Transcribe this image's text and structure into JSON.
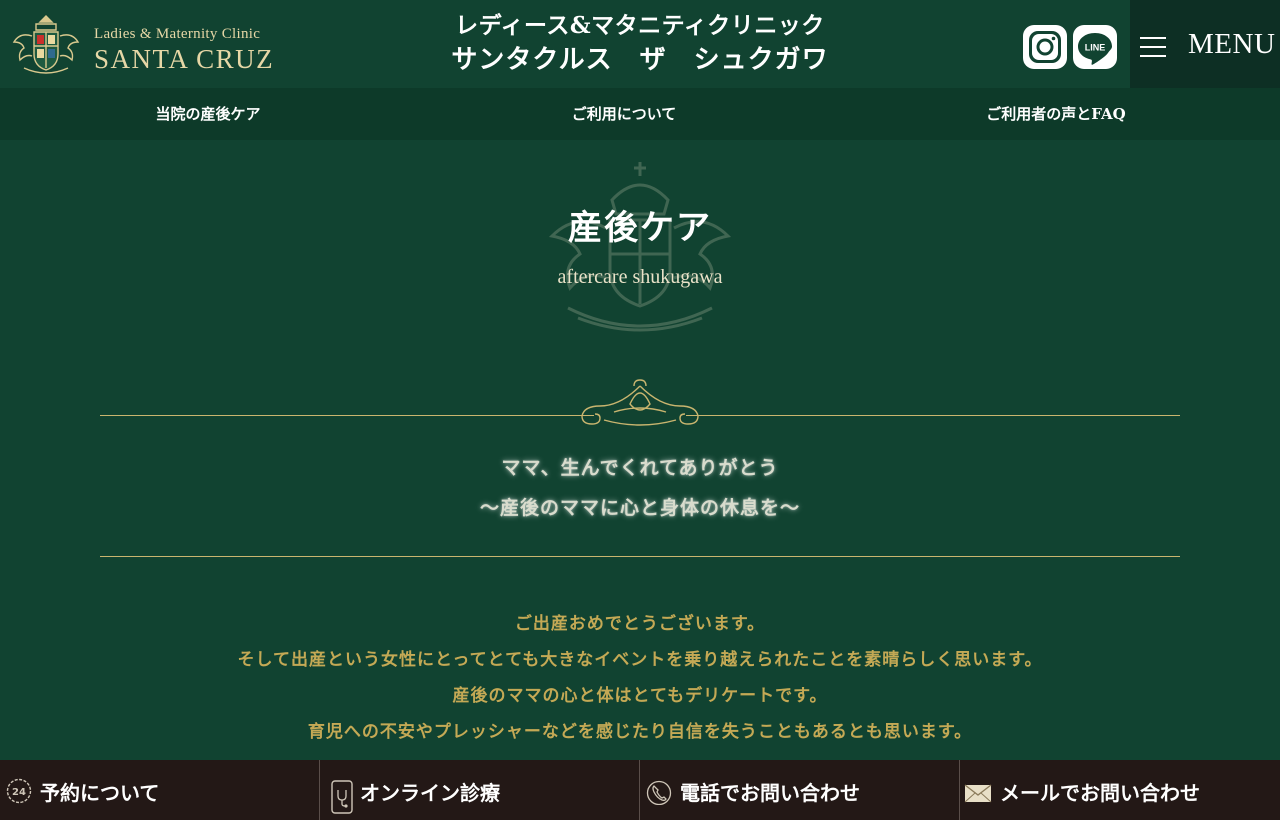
{
  "header": {
    "logo_sub": "Ladies & Maternity Clinic",
    "logo_main": "SANTA CRUZ",
    "title_line1": "レディース&マタニティクリニック",
    "title_line2": "サンタクルス　ザ　シュクガワ",
    "instagram_icon": "instagram-icon",
    "line_icon": "line-icon",
    "line_text": "LINE",
    "menu_label": "MENU"
  },
  "subnav": {
    "items": [
      {
        "label": "当院の産後ケア"
      },
      {
        "label": "ご利用について"
      },
      {
        "label": "ご利用者の声とFAQ"
      }
    ]
  },
  "hero": {
    "title": "産後ケア",
    "subtitle": "aftercare shukugawa"
  },
  "tagline": {
    "line1": "ママ、生んでくれてありがとう",
    "line2": "〜産後のママに心と身体の休息を〜"
  },
  "body": {
    "lines": [
      "ご出産おめでとうございます。",
      "そして出産という女性にとってとても大きなイベントを乗り越えられたことを素晴らしく思います。",
      "産後のママの心と体はとてもデリケートです。",
      "育児への不安やプレッシャーなどを感じたり自信を失うこともあるとも思います。"
    ]
  },
  "bottom_bar": {
    "items": [
      {
        "label": "予約について",
        "icon": "clock-24-icon"
      },
      {
        "label": "オンライン診療",
        "icon": "phone-stethoscope-icon"
      },
      {
        "label": "電話でお問い合わせ",
        "icon": "phone-icon"
      },
      {
        "label": "メールでお問い合わせ",
        "icon": "mail-icon"
      }
    ]
  },
  "colors": {
    "background": "#114331",
    "subnav": "#0d3a29",
    "gold": "#c4a955",
    "bottom_bar": "#231816"
  }
}
